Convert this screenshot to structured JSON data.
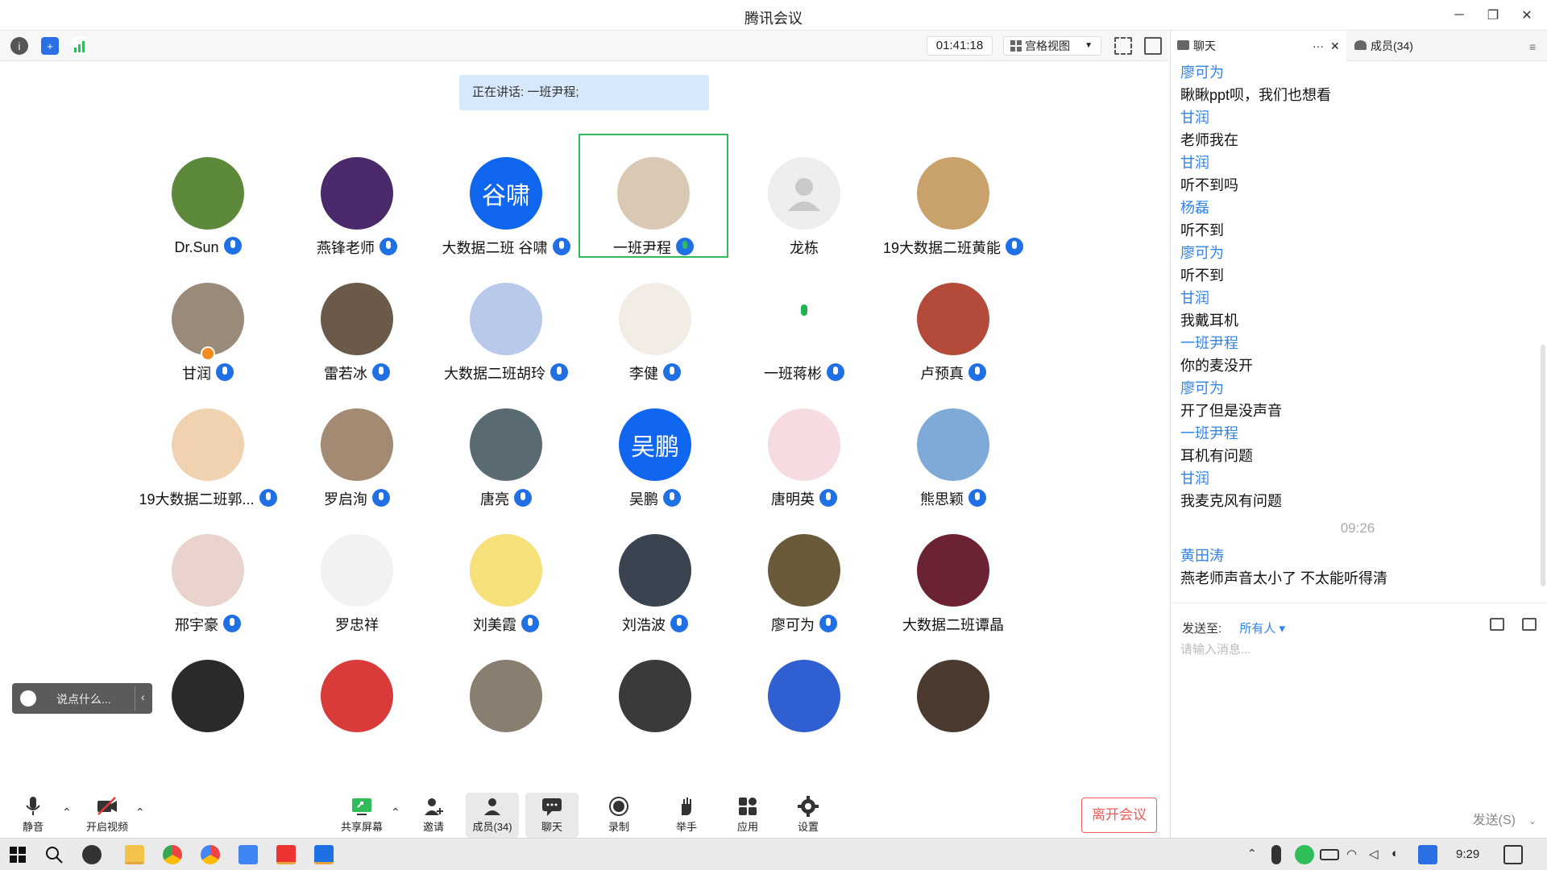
{
  "window": {
    "title": "腾讯会议"
  },
  "toolbar": {
    "timer": "01:41:18",
    "view_mode": "宫格视图"
  },
  "speaking": "正在讲话: 一班尹程;",
  "participants": [
    {
      "name": "Dr.Sun",
      "mic": "on",
      "avatar": "photo",
      "color": "#5d8a3a"
    },
    {
      "name": "燕锋老师",
      "mic": "on",
      "avatar": "photo",
      "color": "#4b2a6b"
    },
    {
      "name": "大数据二班 谷啸",
      "mic": "on",
      "avatar": "text",
      "text": "谷啸",
      "color": "#1166f0"
    },
    {
      "name": "一班尹程",
      "mic": "speaking",
      "avatar": "photo",
      "color": "#d9c8b3"
    },
    {
      "name": "龙栋",
      "mic": "none",
      "avatar": "default",
      "color": "#eeeeee"
    },
    {
      "name": "19大数据二班黄能",
      "mic": "on",
      "avatar": "photo",
      "color": "#c9a26b"
    },
    {
      "name": "甘润",
      "mic": "on",
      "avatar": "photo",
      "color": "#9a8a7a"
    },
    {
      "name": "雷若冰",
      "mic": "on",
      "avatar": "photo",
      "color": "#6b5a4a"
    },
    {
      "name": "大数据二班胡玲",
      "mic": "on",
      "avatar": "photo",
      "color": "#b8c9ec"
    },
    {
      "name": "李健",
      "mic": "on",
      "avatar": "photo",
      "color": "#f3ece4"
    },
    {
      "name": "一班蒋彬",
      "mic": "on",
      "avatar": "none",
      "color": "#ffffff"
    },
    {
      "name": "卢预真",
      "mic": "on",
      "avatar": "photo",
      "color": "#b44a3a"
    },
    {
      "name": "19大数据二班郭...",
      "mic": "on",
      "avatar": "photo",
      "color": "#f0d2b0"
    },
    {
      "name": "罗启洵",
      "mic": "on",
      "avatar": "photo",
      "color": "#a38a72"
    },
    {
      "name": "唐亮",
      "mic": "on",
      "avatar": "photo",
      "color": "#5a6a72"
    },
    {
      "name": "吴鹏",
      "mic": "on",
      "avatar": "text",
      "text": "吴鹏",
      "color": "#1166f0"
    },
    {
      "name": "唐明英",
      "mic": "on",
      "avatar": "photo",
      "color": "#f6dbe1"
    },
    {
      "name": "熊思颖",
      "mic": "on",
      "avatar": "photo",
      "color": "#7fa9d6"
    },
    {
      "name": "邢宇豪",
      "mic": "on",
      "avatar": "photo",
      "color": "#e9d3cc"
    },
    {
      "name": "罗忠祥",
      "mic": "none",
      "avatar": "photo",
      "color": "#f2f2f2"
    },
    {
      "name": "刘美霞",
      "mic": "on",
      "avatar": "photo",
      "color": "#f5e07a"
    },
    {
      "name": "刘浩波",
      "mic": "on",
      "avatar": "photo",
      "color": "#3a4450"
    },
    {
      "name": "廖可为",
      "mic": "on",
      "avatar": "photo",
      "color": "#6b5a3a"
    },
    {
      "name": "大数据二班谭晶",
      "mic": "none",
      "avatar": "photo",
      "color": "#6b2233"
    },
    {
      "name": "",
      "mic": "none",
      "avatar": "photo",
      "color": "#2a2a2a"
    },
    {
      "name": "",
      "mic": "none",
      "avatar": "photo",
      "color": "#d93a3a"
    },
    {
      "name": "",
      "mic": "none",
      "avatar": "photo",
      "color": "#8a7e70"
    },
    {
      "name": "",
      "mic": "none",
      "avatar": "photo",
      "color": "#3a3a3a"
    },
    {
      "name": "",
      "mic": "none",
      "avatar": "photo",
      "color": "#2f5fd0"
    },
    {
      "name": "",
      "mic": "none",
      "avatar": "photo",
      "color": "#4a3a30"
    }
  ],
  "reaction_bar": {
    "placeholder": "说点什么..."
  },
  "bottom_bar": {
    "mute": "静音",
    "video": "开启视频",
    "share": "共享屏幕",
    "invite": "邀请",
    "members": "成员(34)",
    "chat": "聊天",
    "record": "录制",
    "raise_hand": "举手",
    "apps": "应用",
    "settings": "设置",
    "leave": "离开会议"
  },
  "chat": {
    "tab_chat": "聊天",
    "tab_members": "成员(34)",
    "messages": [
      {
        "name": "廖可为",
        "text": "瞅瞅ppt呗，我们也想看"
      },
      {
        "name": "甘润",
        "text": "老师我在"
      },
      {
        "name": "甘润",
        "text": "听不到吗"
      },
      {
        "name": "杨磊",
        "text": "听不到"
      },
      {
        "name": "廖可为",
        "text": "听不到"
      },
      {
        "name": "甘润",
        "text": "我戴耳机"
      },
      {
        "name": "一班尹程",
        "text": "你的麦没开"
      },
      {
        "name": "廖可为",
        "text": "开了但是没声音"
      },
      {
        "name": "一班尹程",
        "text": "耳机有问题"
      },
      {
        "name": "甘润",
        "text": "我麦克风有问题"
      }
    ],
    "time_divider": "09:26",
    "last_message": {
      "name": "黄田涛",
      "text": "燕老师声音太小了 不太能听得清"
    },
    "send_to_label": "发送至:",
    "send_to_value": "所有人",
    "input_placeholder": "请输入消息...",
    "send_button": "发送(S)"
  },
  "taskbar": {
    "time": "9:29"
  }
}
